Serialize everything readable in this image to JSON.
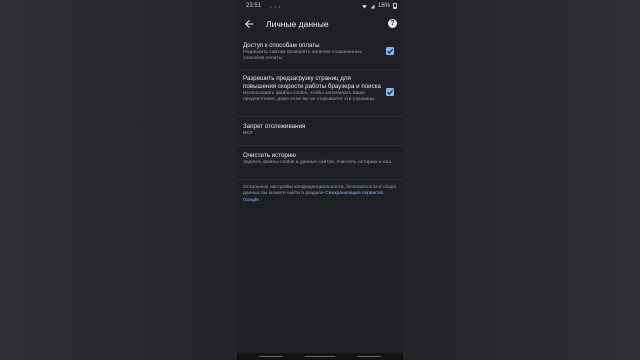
{
  "status": {
    "time": "23:51",
    "dots": "• • •",
    "battery": "18%"
  },
  "appbar": {
    "title": "Личные данные"
  },
  "settings": [
    {
      "title": "Доступ к способам оплаты",
      "subtitle": "Разрешить сайтам проверять наличие сохраненных способов оплаты",
      "checked": true
    },
    {
      "title": "Разрешить предзагрузку страниц для повышения скорости работы браузера и поиска",
      "subtitle": "Использовать файлы cookie, чтобы запоминать ваши предпочтения, даже если вы не открываете эти страницы",
      "checked": true
    },
    {
      "title": "Запрет отслеживания",
      "subtitle": "ВКЛ"
    },
    {
      "title": "Очистить историю",
      "subtitle": "Удалить файлы cookie и данные сайтов, очистить историю и кэш"
    }
  ],
  "footer": {
    "text": "Остальные настройки конфиденциальности, безопасности и сбора данных вы можете найти в разделе ",
    "link": "Синхронизация сервисов Google",
    "end": "."
  },
  "colors": {
    "accent": "#8ab4f8",
    "background": "#1f2023"
  }
}
